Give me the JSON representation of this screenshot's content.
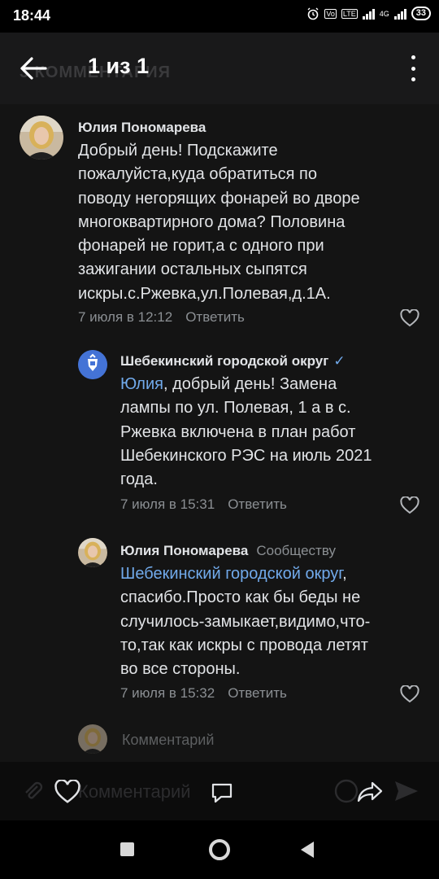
{
  "status_bar": {
    "time": "18:44",
    "network": "4G",
    "battery": "33"
  },
  "header": {
    "title": "1 из 1",
    "ghost_text": "3 КОММЕНТАРИЯ"
  },
  "comments": [
    {
      "author": "Юлия Пономарева",
      "lines": [
        "Добрый день! Подскажите",
        "пожалуйста,куда обратиться по",
        "поводу негорящих фонарей во дворе",
        "многоквартирного дома? Половина",
        "фонарей не горит,а с одного при",
        "зажигании остальных сыпятся",
        "искры.с.Ржевка,ул.Полевая,д.1А."
      ],
      "date": "7 июля в 12:12",
      "reply_label": "Ответить"
    },
    {
      "author": "Шебекинский городской округ",
      "verified_mark": "✓",
      "mention": "Юлия",
      "first_line_rest": ", добрый день! Замена",
      "lines": [
        "лампы по ул. Полевая, 1 а в с.",
        "Ржевка включена в план работ",
        "Шебекинского РЭС на июль 2021",
        "года."
      ],
      "date": "7 июля в 15:31",
      "reply_label": "Ответить"
    },
    {
      "author": "Юлия Пономарева",
      "audience_label": "Сообществу",
      "mention": "Шебекинский городской округ",
      "mention_suffix": ",",
      "lines": [
        "спасибо.Просто как бы беды не",
        "случилось-замыкает,видимо,что-",
        "то,так как искры с провода летят",
        "во все стороны."
      ],
      "date": "7 июля в 15:32",
      "reply_label": "Ответить"
    }
  ],
  "compose": {
    "placeholder": "Комментарий"
  },
  "action_bar": {
    "ghost_text": "Комментарий"
  },
  "colors": {
    "accent": "#71aaeb",
    "background": "#141414",
    "header": "#19191a",
    "text": "#e1e3e6",
    "secondary": "#8b8f93"
  }
}
